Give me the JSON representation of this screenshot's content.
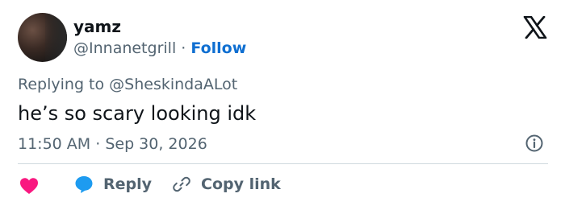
{
  "author": {
    "name": "yamz",
    "handle": "@Innanetgrill",
    "separator": "·",
    "follow_label": "Follow"
  },
  "reply_context": {
    "prefix": "Replying to",
    "mention": "@SheskindaALot"
  },
  "tweet": {
    "text": "he’s so scary looking idk",
    "time": "11:50 AM",
    "separator": "·",
    "date": "Sep 30, 2026"
  },
  "actions": {
    "reply_label": "Reply",
    "copy_link_label": "Copy link"
  },
  "icons": {
    "logo": "x-logo-icon",
    "info": "info-icon",
    "like": "heart-icon",
    "reply": "speech-bubble-icon",
    "copy": "link-icon"
  },
  "colors": {
    "accent": "#0f6fd1",
    "like": "#f91880",
    "reply_icon": "#1d9bf0",
    "muted_text": "#536471"
  }
}
